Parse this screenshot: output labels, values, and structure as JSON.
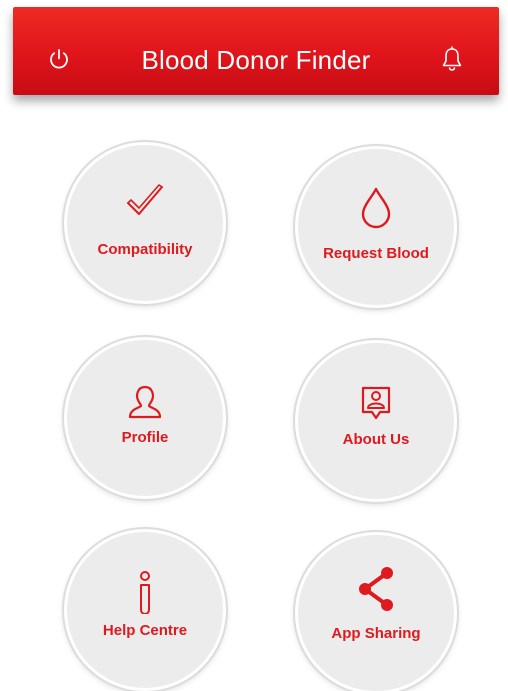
{
  "app_bar": {
    "title": "Blood Donor Finder",
    "left_icon": "power-icon",
    "right_icon": "bell-icon",
    "background_color": "#e0141b",
    "text_color": "#ffffff"
  },
  "menu": {
    "accent_color": "#de1a1f",
    "tile_color": "#ececec",
    "items": [
      {
        "label": "Compatibility",
        "icon": "checkmark-icon"
      },
      {
        "label": "Request Blood",
        "icon": "blood-drop-icon"
      },
      {
        "label": "Profile",
        "icon": "person-icon"
      },
      {
        "label": "About Us",
        "icon": "id-badge-icon"
      },
      {
        "label": "Help Centre",
        "icon": "info-icon"
      },
      {
        "label": "App Sharing",
        "icon": "share-icon"
      }
    ]
  }
}
